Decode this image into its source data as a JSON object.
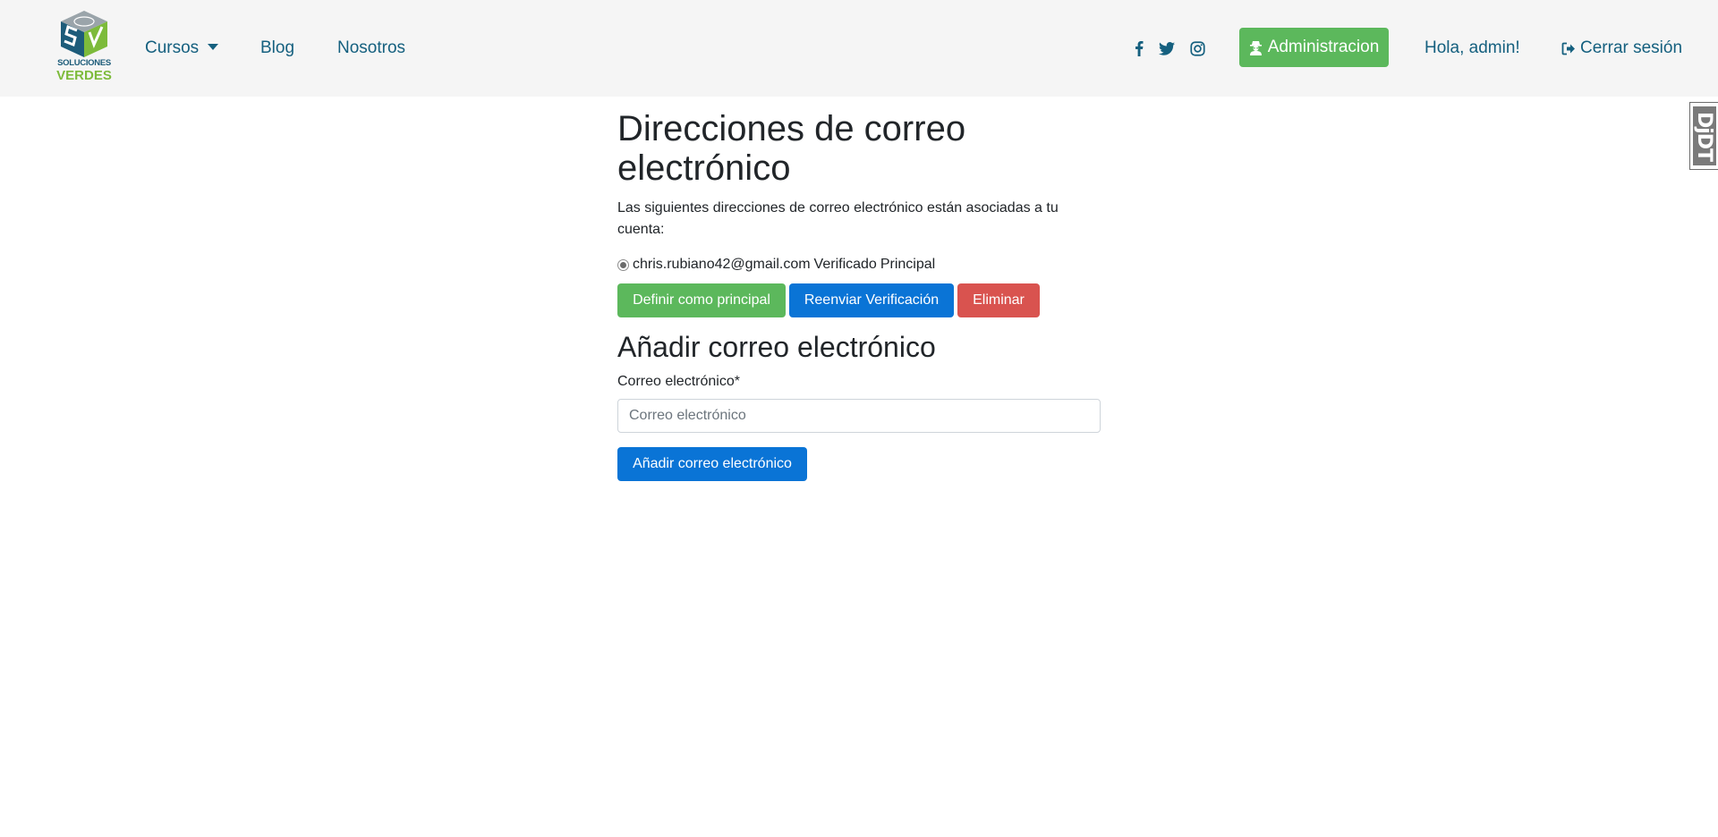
{
  "brand": {
    "line1": "SOLUCIONES",
    "line2": "VERDES",
    "colors": {
      "blue": "#1d5c7a",
      "green": "#7dbb3b"
    }
  },
  "nav": {
    "items": [
      {
        "label": "Cursos",
        "has_dropdown": true
      },
      {
        "label": "Blog"
      },
      {
        "label": "Nosotros"
      }
    ],
    "social": [
      "facebook-icon",
      "twitter-icon",
      "instagram-icon"
    ],
    "admin_label": "Administracion",
    "greeting": "Hola, admin!",
    "logout_label": "Cerrar sesión",
    "link_color": "#15607f"
  },
  "side_widget": {
    "label": "DjDT"
  },
  "page": {
    "title": "Direcciones de correo electrónico",
    "intro": "Las siguientes direcciones de correo electrónico están asociadas a tu cuenta:",
    "email": {
      "address": "chris.rubiano42@gmail.com",
      "status": "Verificado",
      "primary": "Principal",
      "selected": true
    },
    "actions": {
      "make_primary": "Definir como principal",
      "resend": "Reenviar Verificación",
      "remove": "Eliminar"
    },
    "add_section": {
      "title": "Añadir correo electrónico",
      "field_label": "Correo electrónico*",
      "placeholder": "Correo electrónico",
      "value": "",
      "submit": "Añadir correo electrónico"
    }
  },
  "colors": {
    "success": "#5cb85c",
    "primary": "#0a74d6",
    "danger": "#d9534f",
    "navbar_bg": "#f5f5f5"
  }
}
